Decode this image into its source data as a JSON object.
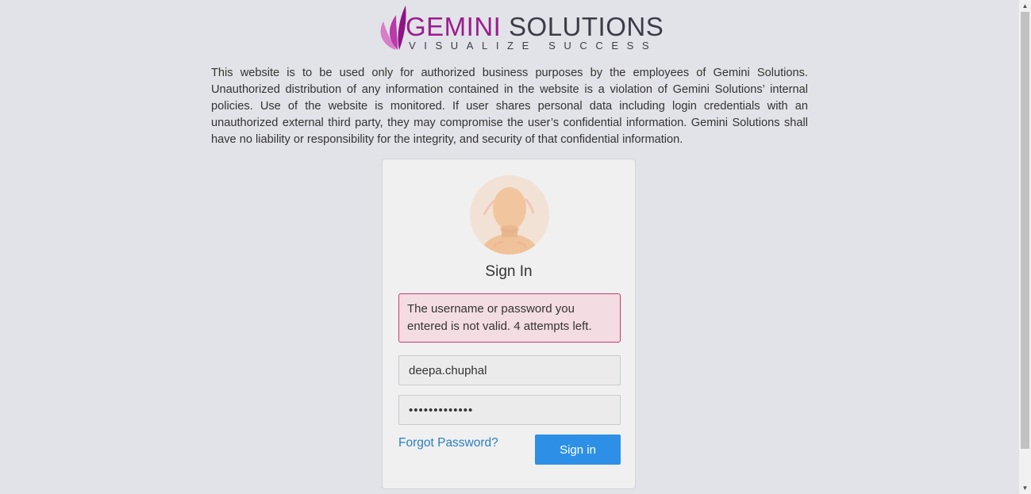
{
  "logo": {
    "brand_first": "GEMINI",
    "brand_second": " SOLUTIONS",
    "tagline": "VISUALIZE SUCCESS",
    "icon": "butterfly-logo-icon"
  },
  "disclaimer": "This website is to be used only for authorized business purposes by the employees of Gemini Solutions. Unauthorized distribution of any information contained in the website is a violation of Gemini Solutions’ internal policies. Use of the website is monitored. If user shares personal data including login credentials with an unauthorized external third party, they may compromise the user’s confidential information. Gemini Solutions shall have no liability or responsibility for the integrity, and security of that confidential information.",
  "signin": {
    "avatar_icon": "user-avatar-icon",
    "title": "Sign In",
    "error": "The username or password you entered is not valid. 4 attempts left.",
    "username_value": "deepa.chuphal",
    "password_value": "•••••••••••••",
    "forgot_label": "Forgot Password?",
    "button_label": "Sign in"
  },
  "colors": {
    "background": "#e2e3e8",
    "brand_purple": "#9b1d8e",
    "primary_button": "#2d90e6",
    "link": "#2a7fc0",
    "error_border": "#d0376c",
    "error_background": "#f4dde2"
  },
  "scrollbar": {
    "up_icon": "scroll-up-arrow-icon",
    "down_icon": "scroll-down-arrow-icon"
  }
}
